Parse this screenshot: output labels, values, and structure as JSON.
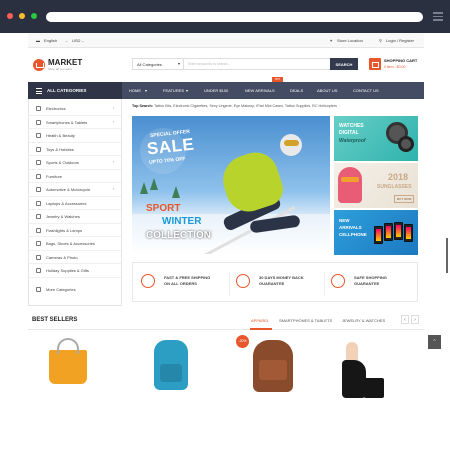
{
  "topbar": {
    "language": "English",
    "currency": "USD",
    "store_location": "Store Location",
    "login": "Login / Register"
  },
  "header": {
    "logo_title": "MARKET",
    "logo_sub": "Shop all you want",
    "search_category": "All Categories",
    "search_placeholder": "Enter keywords to search...",
    "search_button": "SEARCH",
    "cart_title": "SHOPPING CART",
    "cart_summary": "0 item - $0.00"
  },
  "nav": {
    "all_categories": "ALL CATEGORIES",
    "items": [
      "HOME",
      "FEATURES",
      "UNDER $100",
      "NEW ARRIVALS",
      "DEALS",
      "ABOUT US",
      "CONTACT US"
    ],
    "hot": "HOT"
  },
  "sidebar": {
    "items": [
      "Electronics",
      "Smartphones & Tablets",
      "Health & Beauty",
      "Toys & Hobbies",
      "Sports & Outdoors",
      "Furniture",
      "Automotive & Motorcycle",
      "Laptops & Accessories",
      "Jewelry & Watches",
      "Flashlights & Lamps",
      "Bags, Shoes & Accessories",
      "Cameras & Photo",
      "Holiday Supplies & Gifts",
      "More Categories"
    ]
  },
  "top_search": {
    "label": "Top Search:",
    "terms": "Tattoo Kits, Electronic Cigarettes, Sexy Lingerie, Eye Makeup, iPad Mini Cases, Tattoo Supplies, RC Helicopters"
  },
  "banner": {
    "special": "SPECIAL OFFER",
    "sale": "SALE",
    "upto": "UPTO 70% OFF",
    "sport": "SPORT",
    "winter": "WINTER",
    "collection": "COLLECTION"
  },
  "side_banners": {
    "watches": "WATCHES",
    "digital": "DIGITAL",
    "waterproof": "Waterproof",
    "year": "2018",
    "sunglasses": "SUNGLASSES",
    "buy_now": "BUY NOW",
    "new": "NEW",
    "arrivals": "ARRIVALS",
    "cellphone": "CELLPHONE"
  },
  "features": [
    {
      "line1": "FAST & FREE SHIPPING",
      "line2": "ON ALL ORDERS"
    },
    {
      "line1": "30 DAYS MONEY BACK",
      "line2": "GUARANTEE"
    },
    {
      "line1": "SAFE SHOPPING",
      "line2": "GUARANTEE"
    }
  ],
  "best_sellers": {
    "title": "BEST SELLERS",
    "tabs": [
      "APPAREL",
      "SMARTPHONES & TABLETS",
      "JEWELRY & WATCHES"
    ],
    "discount": "-20%"
  },
  "colors": {
    "accent": "#e8572b",
    "nav": "#444c63",
    "nav_dark": "#2f3546",
    "chrome": "#2b3040"
  }
}
